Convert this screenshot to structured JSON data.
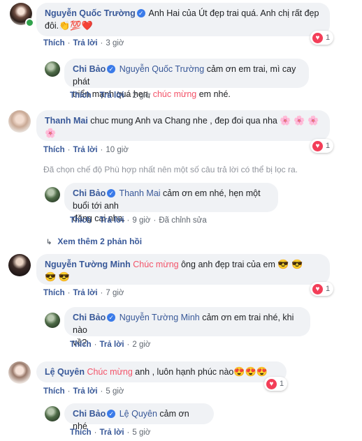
{
  "comments": [
    {
      "author": "Nguyễn Quốc Trường",
      "text": "Anh Hai của Út đẹp trai quá. Anh chị rất đẹp",
      "text2": "đôi.",
      "emoji": "👏💯❤️",
      "like": "Thích",
      "reply": "Trả lời",
      "time": "3 giờ",
      "reaction_count": "1",
      "replies": [
        {
          "author": "Chi Bảo",
          "tag": "Nguyễn Quốc Trường",
          "text": "cảm ơn em trai, mì cay phát",
          "text2a": "triển mạnh quá hen,",
          "chuc": "chúc mừng",
          "text2b": "em nhé.",
          "like": "Thích",
          "reply": "Trả lời",
          "time": "2 giờ"
        }
      ]
    },
    {
      "author": "Thanh Mai",
      "text": "chuc mung Anh va Chang nhe , đep đoi qua nha",
      "emoji": "🌸 🌸 🌸",
      "emoji2": "🌸",
      "like": "Thích",
      "reply": "Trả lời",
      "time": "10 giờ",
      "reaction_count": "1",
      "filter_note": "Đã chọn chế độ Phù hợp nhất nên một số câu trả lời có thể bị lọc ra.",
      "replies": [
        {
          "author": "Chi Bảo",
          "tag": "Thanh Mai",
          "text": "cảm ơn em nhé, hẹn một buổi tới anh",
          "text2": "đăng cai nha.",
          "like": "Thích",
          "reply": "Trả lời",
          "time": "9 giờ",
          "edited": "Đã chỉnh sửa"
        }
      ],
      "more_replies": "Xem thêm 2 phản hồi"
    },
    {
      "author": "Nguyễn Tường Minh",
      "chuc": "Chúc mừng",
      "text": "ông anh đẹp trai của em",
      "emoji": "😎 😎",
      "emoji2": "😎 😎",
      "like": "Thích",
      "reply": "Trả lời",
      "time": "7 giờ",
      "reaction_count": "1",
      "replies": [
        {
          "author": "Chi Bảo",
          "tag": "Nguyễn Tường Minh",
          "text": "cảm ơn em trai nhé, khi nào",
          "text2": "về?",
          "like": "Thích",
          "reply": "Trả lời",
          "time": "2 giờ"
        }
      ]
    },
    {
      "author": "Lệ Quyên",
      "chuc": "Chúc mừng",
      "text": "anh , luôn hạnh phúc nào",
      "emoji": "😍😍😍",
      "like": "Thích",
      "reply": "Trả lời",
      "time": "5 giờ",
      "reaction_count": "1",
      "replies": [
        {
          "author": "Chi Bảo",
          "tag": "Lệ Quyên",
          "text": "cảm ơn nhé",
          "like": "Thích",
          "reply": "Trả lời",
          "time": "5 giờ"
        }
      ]
    }
  ],
  "icons": {
    "verified": "✓",
    "heart": "♥",
    "reply_arrow": "↳"
  },
  "colors": {
    "link": "#385898",
    "chuc_mung": "#f35369",
    "bubble": "#f0f2f5",
    "heart": "#f33e58",
    "verified": "#3b7be9"
  }
}
